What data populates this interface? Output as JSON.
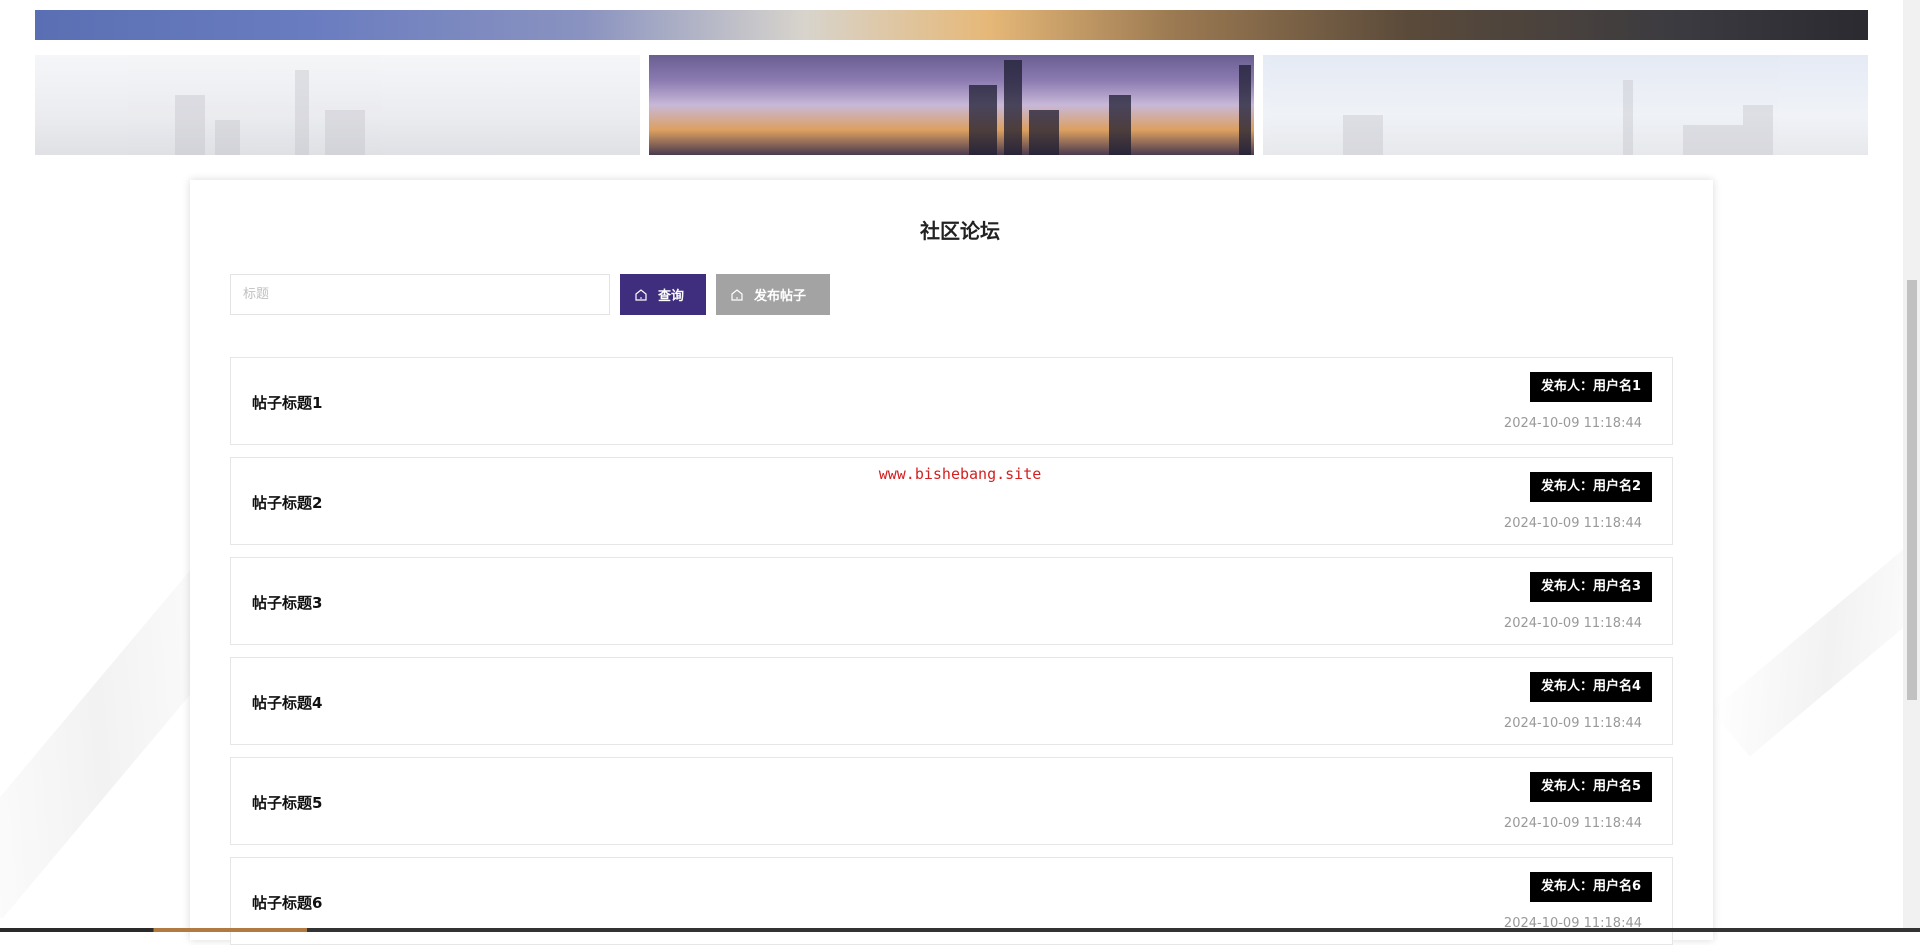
{
  "page": {
    "title": "社区论坛",
    "watermark": "www.bishebang.site"
  },
  "search": {
    "placeholder": "标题",
    "value": ""
  },
  "buttons": {
    "query": "查询",
    "publish": "发布帖子",
    "icon": "home-icon"
  },
  "colors": {
    "query_button": "#3f2d7e",
    "publish_button": "#a3a3a3",
    "tag_bg": "#000000",
    "watermark": "#d42020"
  },
  "posts": [
    {
      "title": "帖子标题1",
      "author": "发布人：用户名1",
      "date": "2024-10-09 11:18:44"
    },
    {
      "title": "帖子标题2",
      "author": "发布人：用户名2",
      "date": "2024-10-09 11:18:44"
    },
    {
      "title": "帖子标题3",
      "author": "发布人：用户名3",
      "date": "2024-10-09 11:18:44"
    },
    {
      "title": "帖子标题4",
      "author": "发布人：用户名4",
      "date": "2024-10-09 11:18:44"
    },
    {
      "title": "帖子标题5",
      "author": "发布人：用户名5",
      "date": "2024-10-09 11:18:44"
    },
    {
      "title": "帖子标题6",
      "author": "发布人：用户名6",
      "date": "2024-10-09 11:18:44"
    }
  ]
}
